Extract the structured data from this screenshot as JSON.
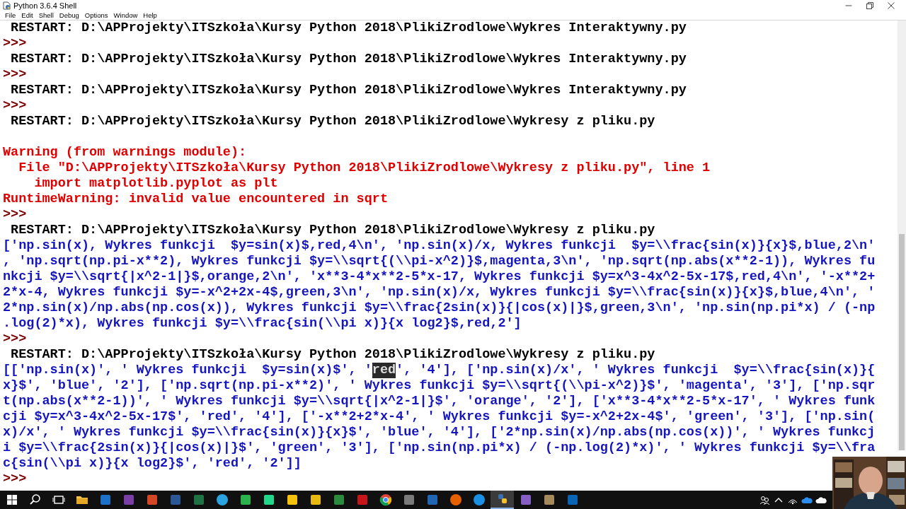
{
  "window": {
    "title": "Python 3.6.4 Shell"
  },
  "menu": [
    "File",
    "Edit",
    "Shell",
    "Debug",
    "Options",
    "Window",
    "Help"
  ],
  "shell": {
    "lines": [
      {
        "kind": "restart",
        "text": " RESTART: D:\\APProjekty\\ITSzkoła\\Kursy Python 2018\\PlikiZrodlowe\\Wykres Interaktywny.py"
      },
      {
        "kind": "prompt",
        "text": ">>>"
      },
      {
        "kind": "restart",
        "text": " RESTART: D:\\APProjekty\\ITSzkoła\\Kursy Python 2018\\PlikiZrodlowe\\Wykres Interaktywny.py"
      },
      {
        "kind": "prompt",
        "text": ">>>"
      },
      {
        "kind": "restart",
        "text": " RESTART: D:\\APProjekty\\ITSzkoła\\Kursy Python 2018\\PlikiZrodlowe\\Wykres Interaktywny.py"
      },
      {
        "kind": "prompt",
        "text": ">>>"
      },
      {
        "kind": "restart",
        "text": " RESTART: D:\\APProjekty\\ITSzkoła\\Kursy Python 2018\\PlikiZrodlowe\\Wykresy z pliku.py"
      },
      {
        "kind": "blank"
      },
      {
        "kind": "error",
        "text": "Warning (from warnings module):"
      },
      {
        "kind": "error",
        "text": "  File \"D:\\APProjekty\\ITSzkoła\\Kursy Python 2018\\PlikiZrodlowe\\Wykresy z pliku.py\", line 1"
      },
      {
        "kind": "error",
        "text": "    import matplotlib.pyplot as plt"
      },
      {
        "kind": "error",
        "text": "RuntimeWarning: invalid value encountered in sqrt"
      },
      {
        "kind": "prompt",
        "text": ">>>"
      },
      {
        "kind": "restart",
        "text": " RESTART: D:\\APProjekty\\ITSzkoła\\Kursy Python 2018\\PlikiZrodlowe\\Wykresy z pliku.py"
      },
      {
        "kind": "output",
        "text": "['np.sin(x), Wykres funkcji  $y=sin(x)$,red,4\\n', 'np.sin(x)/x, Wykres funkcji  $y=\\\\frac{sin(x)}{x}$,blue,2\\n'"
      },
      {
        "kind": "output",
        "text": ", 'np.sqrt(np.pi-x**2), Wykres funkcji $y=\\\\sqrt{(\\\\pi-x^2)}$,magenta,3\\n', 'np.sqrt(np.abs(x**2-1)), Wykres fu"
      },
      {
        "kind": "output",
        "text": "nkcji $y=\\\\sqrt{|x^2-1|}$,orange,2\\n', 'x**3-4*x**2-5*x-17, Wykres funkcji $y=x^3-4x^2-5x-17$,red,4\\n', '-x**2+"
      },
      {
        "kind": "output",
        "text": "2*x-4, Wykres funkcji $y=-x^2+2x-4$,green,3\\n', 'np.sin(x)/x, Wykres funkcji $y=\\\\frac{sin(x)}{x}$,blue,4\\n', '"
      },
      {
        "kind": "output",
        "text": "2*np.sin(x)/np.abs(np.cos(x)), Wykres funkcji $y=\\\\frac{2sin(x)}{|cos(x)|}$,green,3\\n', 'np.sin(np.pi*x) / (-np"
      },
      {
        "kind": "output",
        "text": ".log(2)*x), Wykres funkcji $y=\\\\frac{sin(\\\\pi x)}{x log2}$,red,2']"
      },
      {
        "kind": "prompt",
        "text": ">>>"
      },
      {
        "kind": "restart",
        "text": " RESTART: D:\\APProjekty\\ITSzkoła\\Kursy Python 2018\\PlikiZrodlowe\\Wykresy z pliku.py"
      },
      {
        "kind": "output",
        "parts": [
          {
            "text": "[['np.sin(x)', ' Wykres funkcji  $y=sin(x)$', '",
            "selected": false
          },
          {
            "text": "red",
            "selected": true
          },
          {
            "text": "', '4'], ['np.sin(x)/x', ' Wykres funkcji  $y=\\\\frac{sin(x)}{",
            "selected": false
          }
        ]
      },
      {
        "kind": "output",
        "text": "x}$', 'blue', '2'], ['np.sqrt(np.pi-x**2)', ' Wykres funkcji $y=\\\\sqrt{(\\\\pi-x^2)}$', 'magenta', '3'], ['np.sqr"
      },
      {
        "kind": "output",
        "text": "t(np.abs(x**2-1))', ' Wykres funkcji $y=\\\\sqrt{|x^2-1|}$', 'orange', '2'], ['x**3-4*x**2-5*x-17', ' Wykres funk"
      },
      {
        "kind": "output",
        "text": "cji $y=x^3-4x^2-5x-17$', 'red', '4'], ['-x**2+2*x-4', ' Wykres funkcji $y=-x^2+2x-4$', 'green', '3'], ['np.sin("
      },
      {
        "kind": "output",
        "text": "x)/x', ' Wykres funkcji $y=\\\\frac{sin(x)}{x}$', 'blue', '4'], ['2*np.sin(x)/np.abs(np.cos(x))', ' Wykres funkcj"
      },
      {
        "kind": "output",
        "text": "i $y=\\\\frac{2sin(x)}{|cos(x)|}$', 'green', '3'], ['np.sin(np.pi*x) / (-np.log(2)*x)', ' Wykres funkcji $y=\\\\fra"
      },
      {
        "kind": "output",
        "text": "c{sin(\\\\pi x)}{x log2}$', 'red', '2']]"
      },
      {
        "kind": "prompt",
        "text": ">>>"
      }
    ]
  }
}
